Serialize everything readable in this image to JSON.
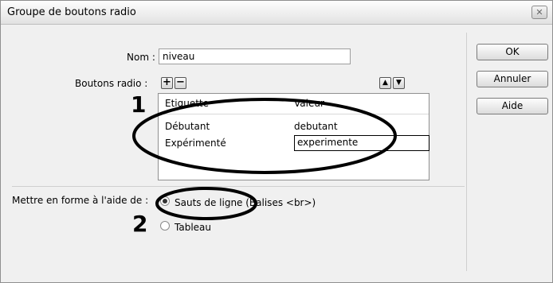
{
  "dialog": {
    "title": "Groupe de boutons radio",
    "close_icon": "close-icon"
  },
  "form": {
    "name_label": "Nom :",
    "name_value": "niveau",
    "radio_buttons_label": "Boutons radio :",
    "add_symbol": "+",
    "remove_symbol": "−",
    "up_symbol": "▲",
    "down_symbol": "▼"
  },
  "table": {
    "columns": [
      "Etiquette",
      "Valeur"
    ],
    "rows": [
      {
        "label": "Débutant",
        "value": "debutant"
      },
      {
        "label": "Expérimenté",
        "value": "experimente"
      }
    ]
  },
  "layout": {
    "format_label": "Mettre en forme à l'aide de :",
    "options": [
      {
        "label": "Sauts de ligne (Balises <br>)",
        "selected": true
      },
      {
        "label": "Tableau",
        "selected": false
      }
    ]
  },
  "buttons": {
    "ok": "OK",
    "cancel": "Annuler",
    "help": "Aide"
  },
  "annotations": {
    "marker_1": "1",
    "marker_2": "2"
  }
}
